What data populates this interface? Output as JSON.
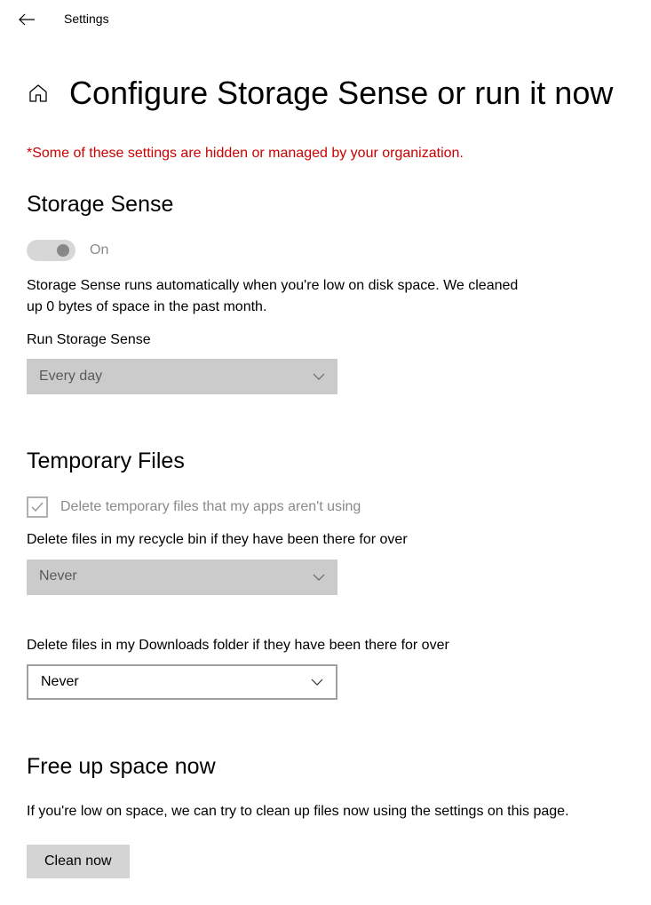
{
  "topbar": {
    "title": "Settings"
  },
  "header": {
    "title": "Configure Storage Sense or run it now"
  },
  "warning": "*Some of these settings are hidden or managed by your organization.",
  "storage_sense": {
    "heading": "Storage Sense",
    "toggle_label": "On",
    "description": "Storage Sense runs automatically when you're low on disk space. We cleaned up 0 bytes of space in the past month.",
    "run_label": "Run Storage Sense",
    "run_value": "Every day"
  },
  "temp_files": {
    "heading": "Temporary Files",
    "checkbox_label": "Delete temporary files that my apps aren't using",
    "recycle_label": "Delete files in my recycle bin if they have been there for over",
    "recycle_value": "Never",
    "downloads_label": "Delete files in my Downloads folder if they have been there for over",
    "downloads_value": "Never"
  },
  "free_up": {
    "heading": "Free up space now",
    "description": "If you're low on space, we can try to clean up files now using the settings on this page.",
    "button_label": "Clean now"
  }
}
